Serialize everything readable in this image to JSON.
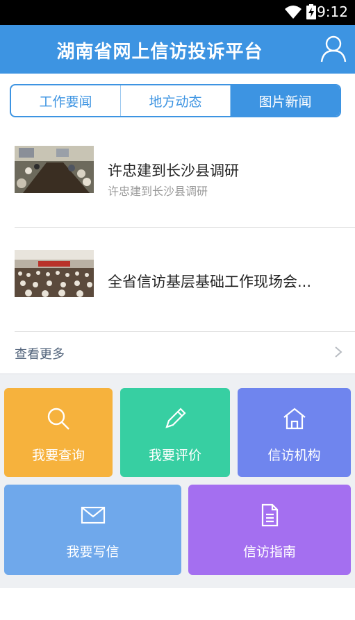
{
  "status_bar": {
    "time": "9:12",
    "icons": [
      "wifi-icon",
      "battery-charging-icon"
    ]
  },
  "app_bar": {
    "title": "湖南省网上信访投诉平台",
    "icon": "user-icon"
  },
  "tabs": [
    {
      "label": "工作要闻",
      "active": false
    },
    {
      "label": "地方动态",
      "active": false
    },
    {
      "label": "图片新闻",
      "active": true
    }
  ],
  "news": [
    {
      "headline": "许忠建到长沙县调研",
      "subtitle": "许忠建到长沙县调研"
    },
    {
      "headline": "全省信访基层基础工作现场会..."
    }
  ],
  "more": {
    "label": "查看更多",
    "icon": "chevron-right-icon"
  },
  "tiles": [
    {
      "label": "我要查询",
      "icon": "search-icon",
      "color": "#f6b23d"
    },
    {
      "label": "我要评价",
      "icon": "pen-icon",
      "color": "#37cfa2"
    },
    {
      "label": "信访机构",
      "icon": "building-icon",
      "color": "#6f85ee"
    },
    {
      "label": "我要写信",
      "icon": "envelope-icon",
      "color": "#6fa8eb"
    },
    {
      "label": "信访指南",
      "icon": "document-icon",
      "color": "#a46ff0"
    }
  ]
}
